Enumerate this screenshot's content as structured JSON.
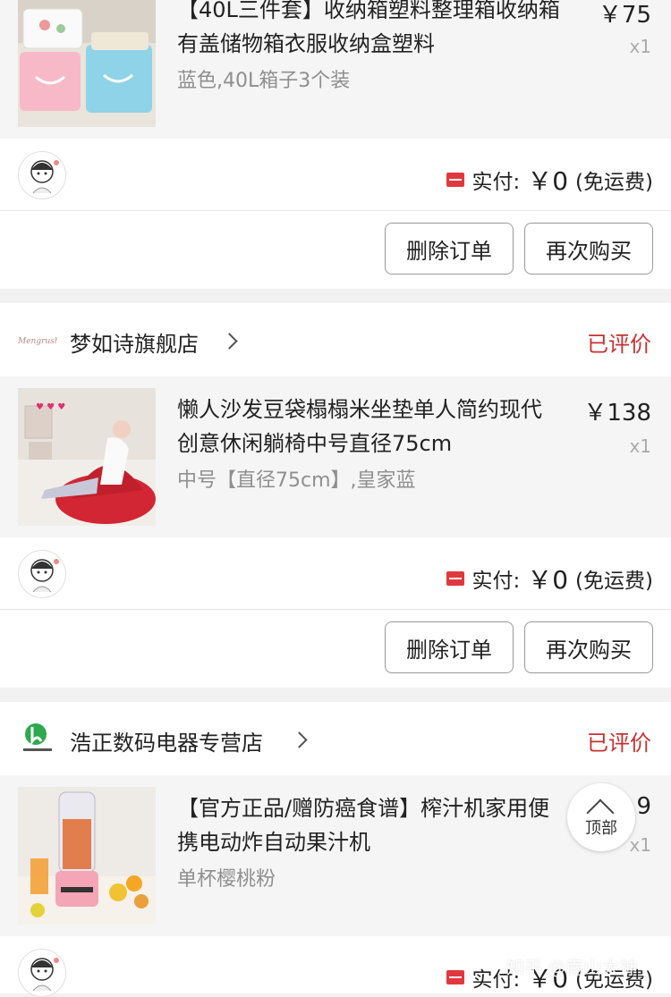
{
  "orders": [
    {
      "product": {
        "title": "【40L三件套】收纳箱塑料整理箱收纳箱有盖储物箱衣服收纳盒塑料",
        "attrs": "蓝色,40L箱子3个装",
        "price": "￥75",
        "qty": "x1"
      },
      "payment": {
        "label": "实付:",
        "amount": "￥0",
        "note": "(免运费)"
      },
      "buttons": {
        "delete": "删除订单",
        "rebuy": "再次购买"
      }
    },
    {
      "store": {
        "name": "梦如诗旗舰店",
        "status": "已评价"
      },
      "product": {
        "title": "懒人沙发豆袋榻榻米坐垫单人简约现代创意休闲躺椅中号直径75cm",
        "attrs": "中号【直径75cm】,皇家蓝",
        "price": "￥138",
        "qty": "x1"
      },
      "payment": {
        "label": "实付:",
        "amount": "￥0",
        "note": "(免运费)"
      },
      "buttons": {
        "delete": "删除订单",
        "rebuy": "再次购买"
      }
    },
    {
      "store": {
        "name": "浩正数码电器专营店",
        "status": "已评价"
      },
      "product": {
        "title": "【官方正品/赠防癌食谱】榨汁机家用便携电动炸自动果汁机",
        "attrs": "单杯樱桃粉",
        "price_partial": "9",
        "qty": "x1"
      },
      "payment": {
        "label": "实付:",
        "amount": "￥0",
        "note": "(免运费)"
      }
    }
  ],
  "back_to_top": {
    "label": "顶部"
  },
  "watermark": "知乎 @南山大神",
  "colors": {
    "status": "#c8302f",
    "pay_tag": "#e0383e",
    "page_bg": "#f2f2f2"
  },
  "icons": {
    "pay_tag": "red-ticket-icon",
    "chevron": "chevron-right-icon",
    "back_to_top": "chevron-up-icon"
  }
}
